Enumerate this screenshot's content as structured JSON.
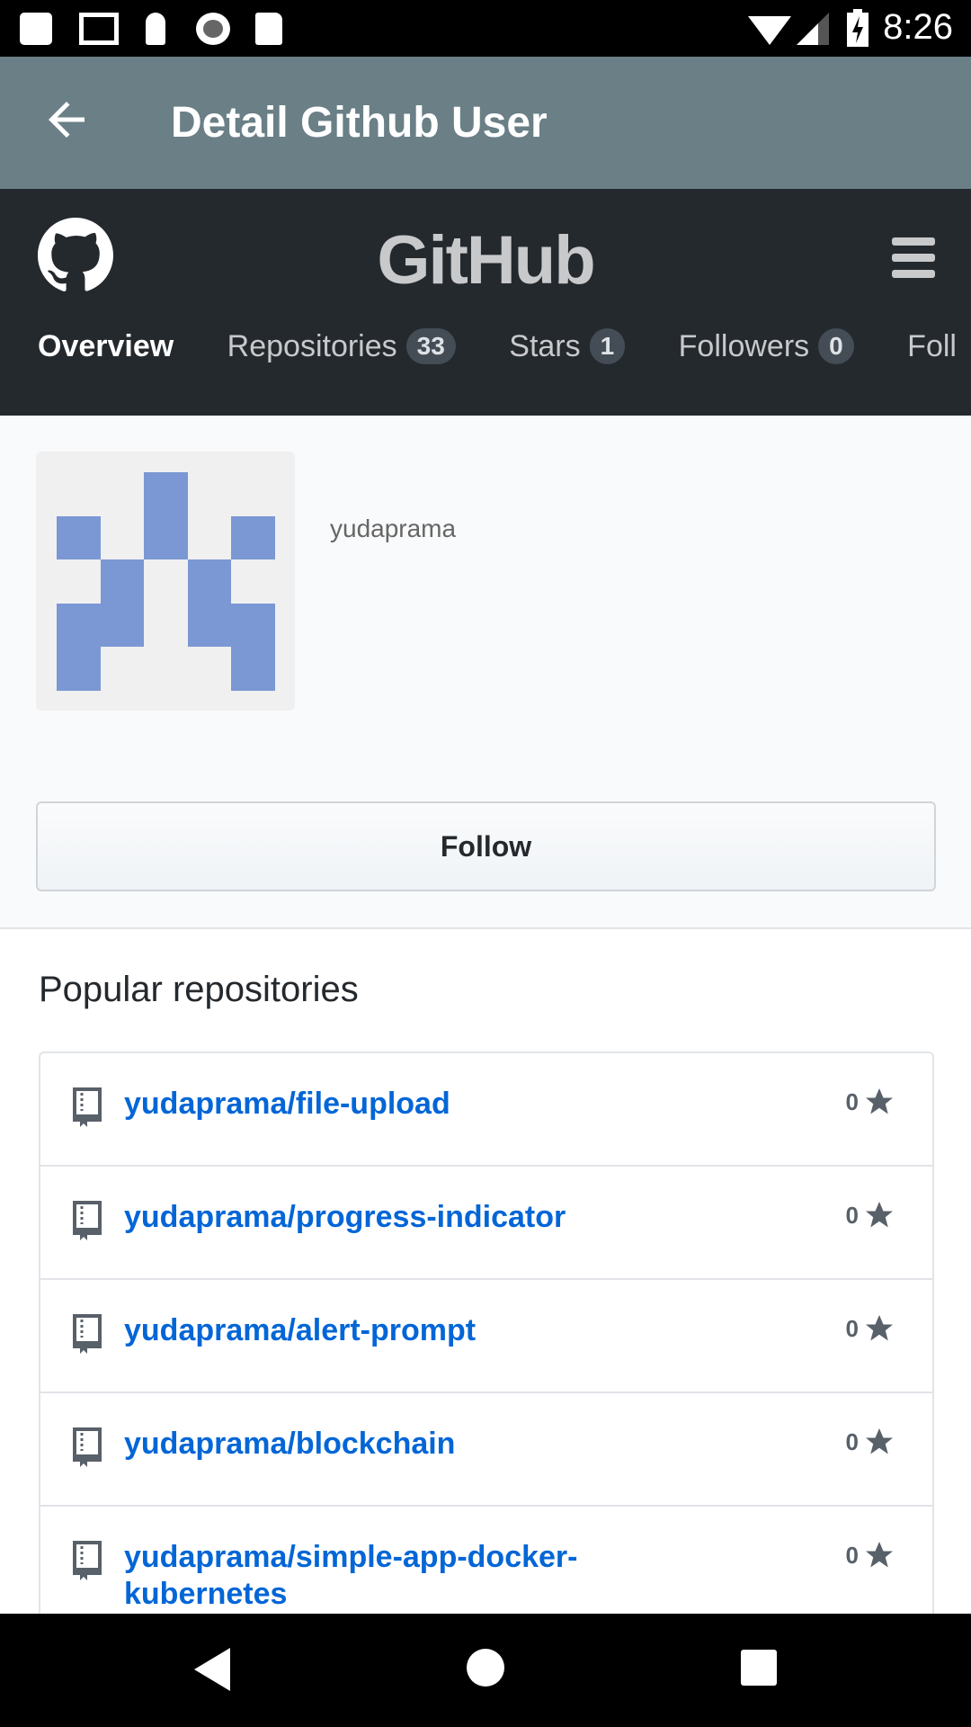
{
  "status_bar": {
    "time": "8:26",
    "icons": [
      "notification-icon",
      "gmail-icon",
      "keyhole-icon",
      "record-icon",
      "sd-card-icon",
      "wifi-icon",
      "signal-icon",
      "battery-charging-icon"
    ]
  },
  "app_bar": {
    "title": "Detail Github User",
    "back_icon": "arrow-back-icon"
  },
  "github_header": {
    "wordmark": "GitHub",
    "tabs": [
      {
        "label": "Overview",
        "active": true
      },
      {
        "label": "Repositories",
        "count": "33"
      },
      {
        "label": "Stars",
        "count": "1"
      },
      {
        "label": "Followers",
        "count": "0"
      },
      {
        "label": "Foll"
      }
    ]
  },
  "profile": {
    "username": "yudaprama",
    "avatar_color": "#7b97d4",
    "follow_label": "Follow"
  },
  "popular": {
    "heading": "Popular repositories",
    "repos": [
      {
        "name": "yudaprama/file-upload",
        "stars": "0"
      },
      {
        "name": "yudaprama/progress-indicator",
        "stars": "0"
      },
      {
        "name": "yudaprama/alert-prompt",
        "stars": "0"
      },
      {
        "name": "yudaprama/blockchain",
        "stars": "0"
      },
      {
        "name": "yudaprama/simple-app-docker-kubernetes",
        "stars": "0"
      }
    ]
  },
  "colors": {
    "app_bar": "#6a7f86",
    "header": "#24292e",
    "link": "#0366d6"
  }
}
